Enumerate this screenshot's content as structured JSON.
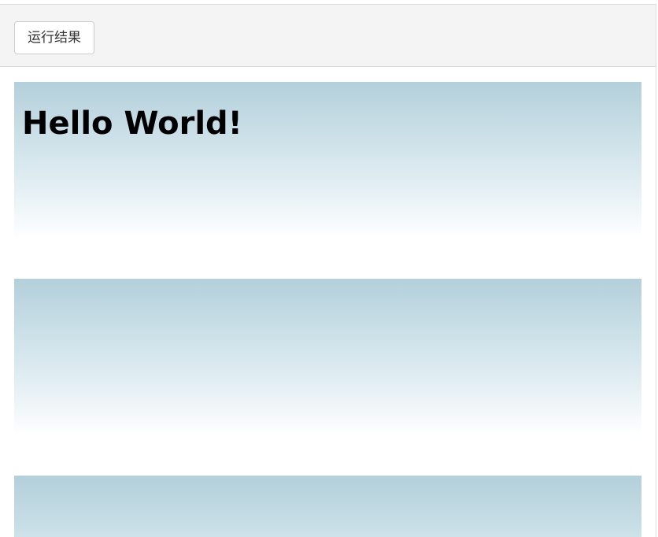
{
  "toolbar": {
    "run_button_label": "运行结果"
  },
  "result": {
    "heading": "Hello World!"
  },
  "colors": {
    "toolbar_bg": "#f4f4f4",
    "panel_gradient_top": "#b3d0db",
    "panel_gradient_bottom": "#ffffff"
  }
}
